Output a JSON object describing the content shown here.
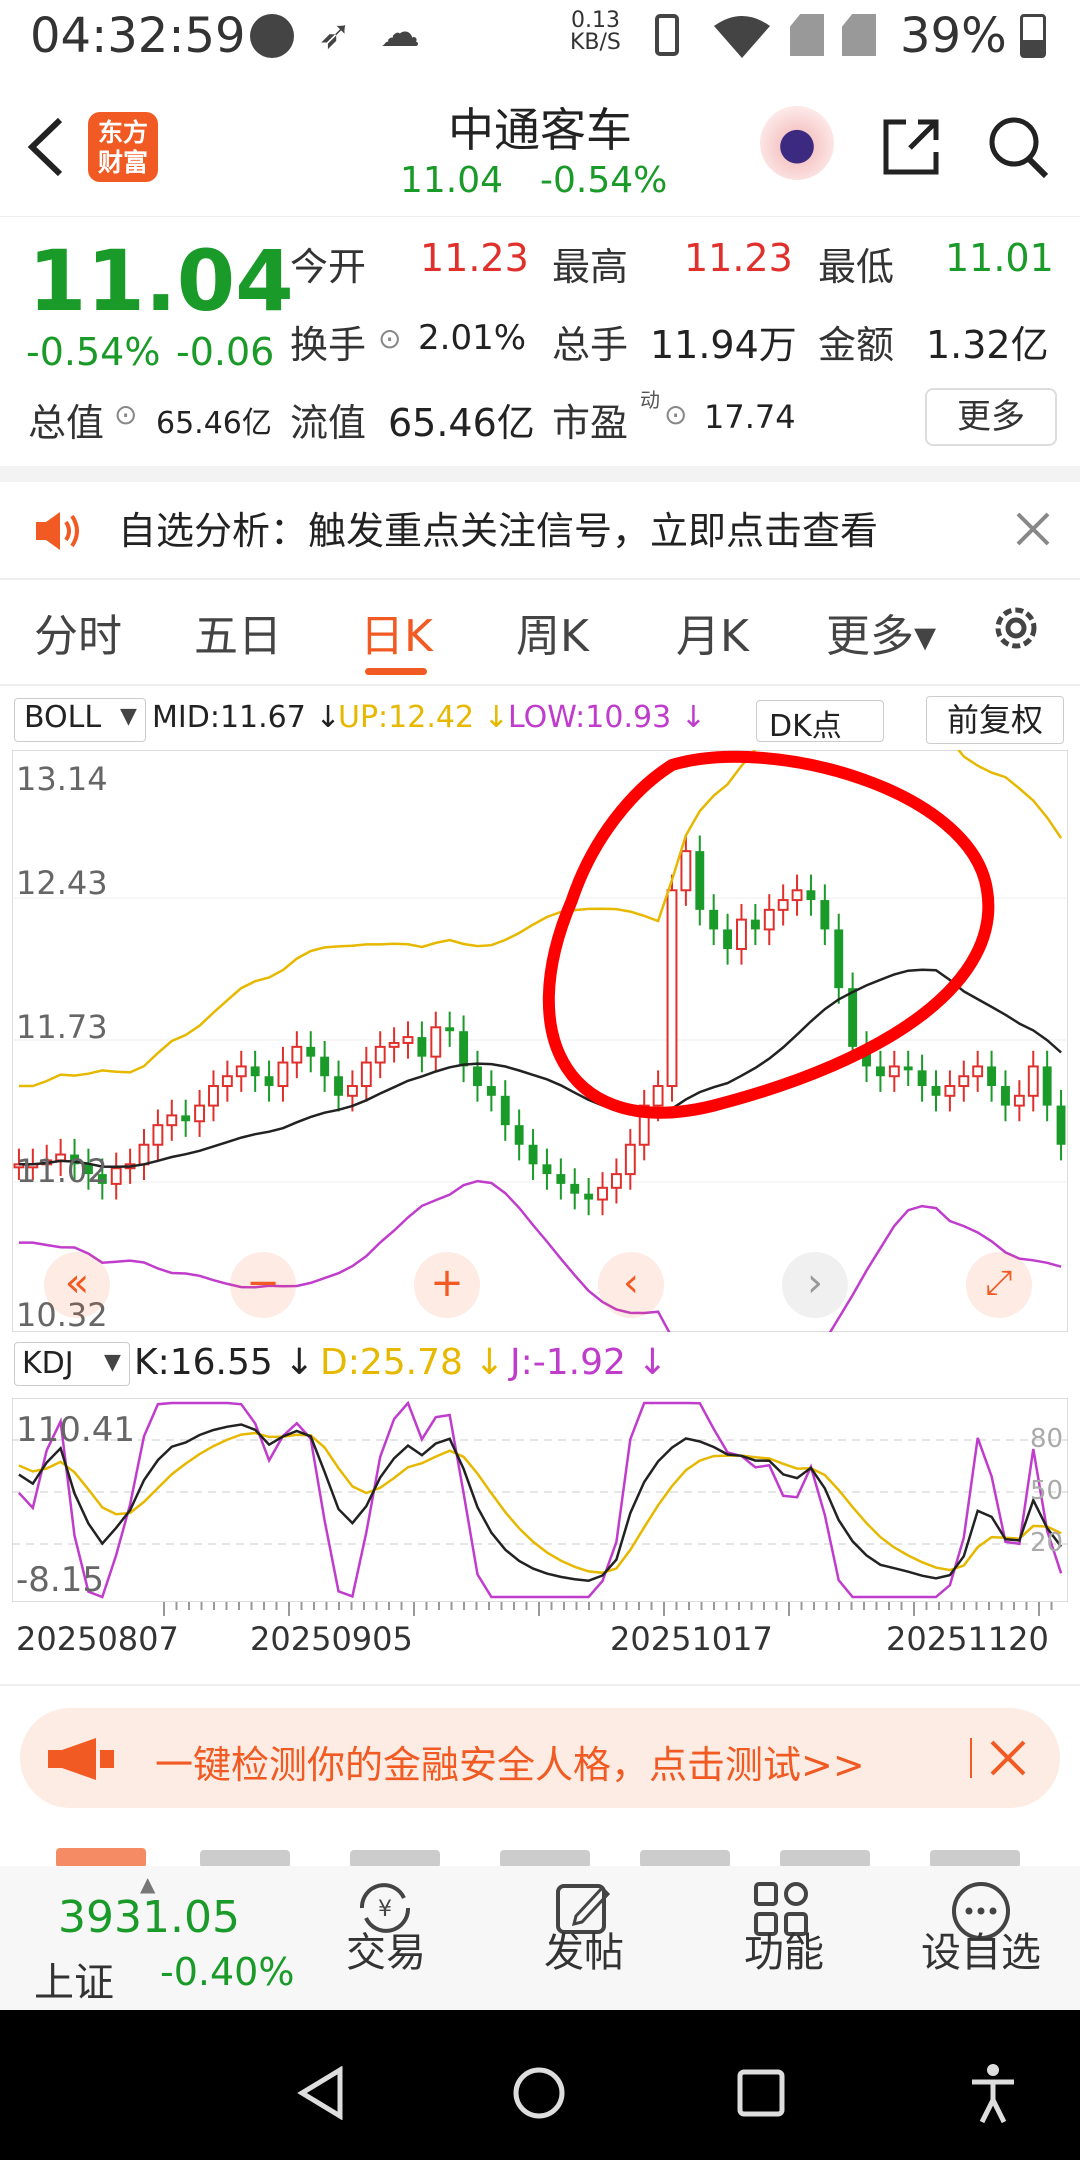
{
  "status": {
    "time": "04:32:59",
    "net_speed_value": "0.13",
    "net_speed_unit": "KB/S",
    "battery": "39%"
  },
  "header": {
    "logo_line1": "东方",
    "logo_line2": "财富",
    "stock_name": "中通客车",
    "price": "11.04",
    "change_pct": "-0.54%"
  },
  "quote": {
    "price": "11.04",
    "change_pct": "-0.54%",
    "change_amt": "-0.06",
    "open_label": "今开",
    "open_value": "11.23",
    "high_label": "最高",
    "high_value": "11.23",
    "low_label": "最低",
    "low_value": "11.01",
    "turnover_label": "换手",
    "turnover_value": "2.01%",
    "volume_label": "总手",
    "volume_value": "11.94万",
    "amount_label": "金额",
    "amount_value": "1.32亿",
    "mktcap_label": "总值",
    "mktcap_value": "65.46亿",
    "float_label": "流值",
    "float_value": "65.46亿",
    "pe_label": "市盈",
    "pe_sup": "动",
    "pe_value": "17.74",
    "more_label": "更多"
  },
  "notice": {
    "text": "自选分析：触发重点关注信号，立即点击查看"
  },
  "tabs": [
    {
      "label": "分时"
    },
    {
      "label": "五日"
    },
    {
      "label": "日K"
    },
    {
      "label": "周K"
    },
    {
      "label": "月K"
    },
    {
      "label": "更多▾"
    }
  ],
  "boll": {
    "name": "BOLL",
    "mid": "MID:11.67 ↓",
    "up": "UP:12.42 ↓",
    "low": "LOW:10.93 ↓",
    "dk": "DK点",
    "adjust": "前复权",
    "axis": [
      "13.14",
      "12.43",
      "11.73",
      "11.02",
      "10.32"
    ]
  },
  "kdj": {
    "name": "KDJ",
    "k": "K:16.55 ↓",
    "d": "D:25.78 ↓",
    "j": "J:-1.92 ↓",
    "axis_top": "110.41",
    "axis_bottom": "-8.15",
    "levels": [
      "80",
      "50",
      "20"
    ]
  },
  "dates": [
    "20250807",
    "20250905",
    "20251017",
    "20251120"
  ],
  "colors": {
    "up": "#e0302c",
    "down": "#1a9a28",
    "accent": "#f15a22",
    "mid_line": "#222222",
    "upper_band": "#e6b800",
    "lower_band": "#c03ccc",
    "annotation": "#ff0000"
  },
  "banner": {
    "text": "一键检测你的金融安全人格，点击测试>>"
  },
  "bottom": {
    "index_value": "3931.05",
    "index_name": "上证",
    "index_change": "-0.40%",
    "items": [
      {
        "label": "交易",
        "icon": "yen-cycle-icon"
      },
      {
        "label": "发帖",
        "icon": "edit-icon"
      },
      {
        "label": "功能",
        "icon": "grid-icon"
      },
      {
        "label": "设自选",
        "icon": "more-circle-icon"
      }
    ]
  }
}
